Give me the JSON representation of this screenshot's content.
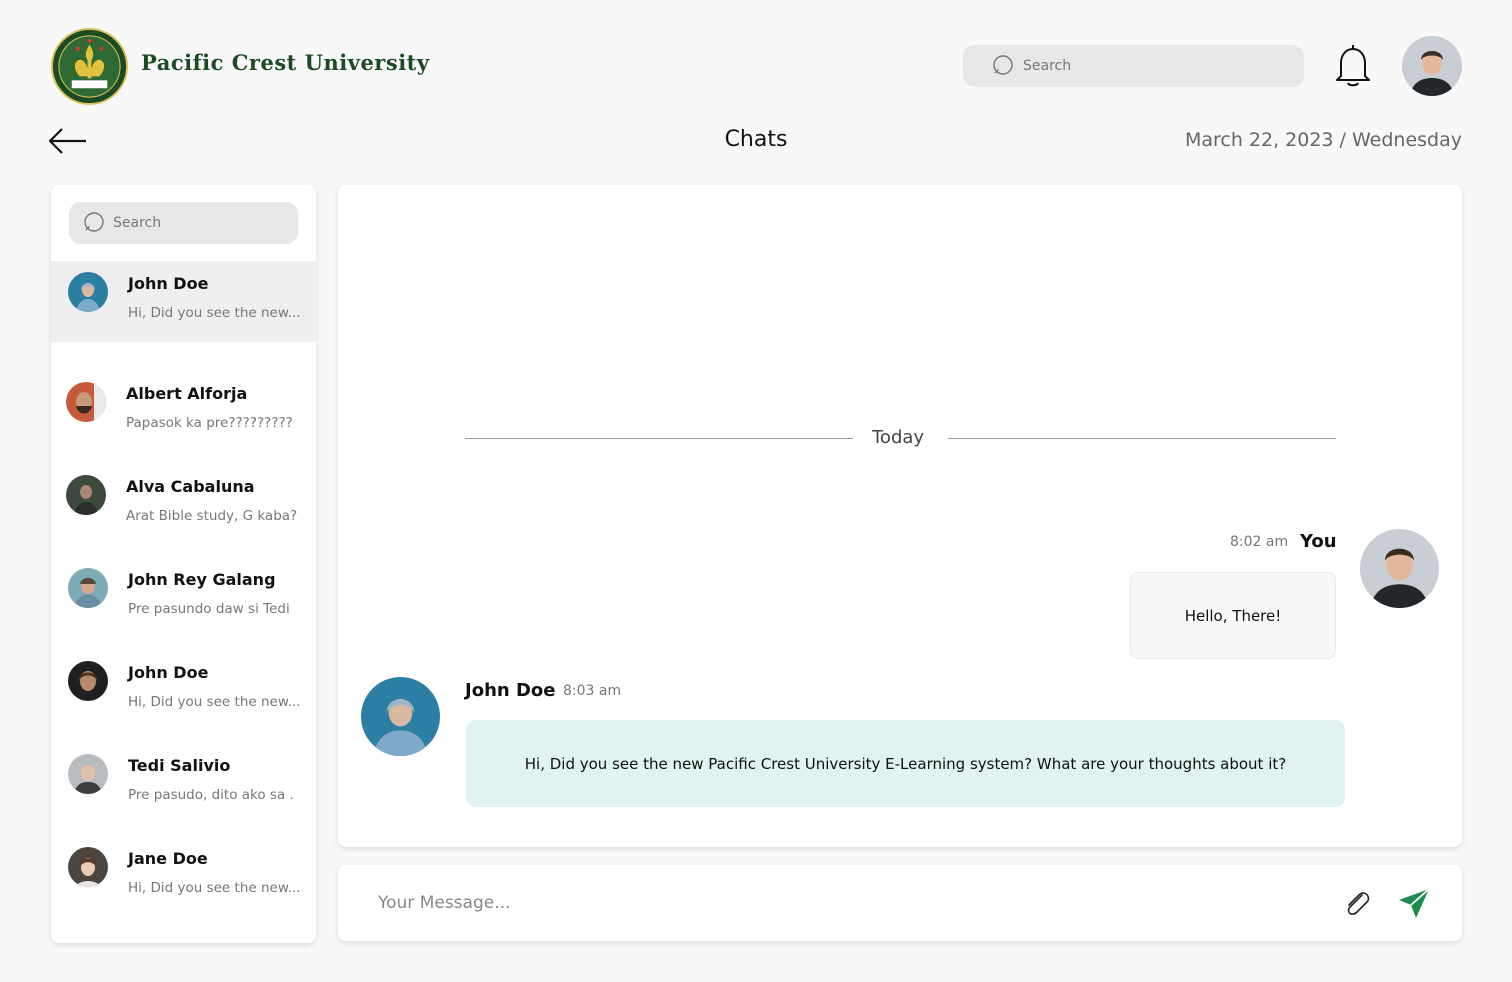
{
  "brand": {
    "name": "Pacific Crest University",
    "logo_icon": "university-crest-logo"
  },
  "header": {
    "search_placeholder": "Search",
    "notification_icon": "bell-icon",
    "back_icon": "arrow-left-icon",
    "title": "Chats",
    "date": "March 22, 2023 / Wednesday"
  },
  "sidebar": {
    "search_placeholder": "Search",
    "chats": [
      {
        "name": "John Doe",
        "preview": "Hi, Did you see the new...",
        "active": true
      },
      {
        "name": "Albert Alforja",
        "preview": "Papasok ka pre?????????"
      },
      {
        "name": "Alva Cabaluna",
        "preview": "Arat Bible study, G kaba?"
      },
      {
        "name": "John Rey Galang",
        "preview": "Pre pasundo daw si Tedi"
      },
      {
        "name": "John Doe",
        "preview": "Hi, Did you see the new..."
      },
      {
        "name": "Tedi Salivio",
        "preview": "Pre pasudo, dito ako sa ."
      },
      {
        "name": "Jane Doe",
        "preview": "Hi, Did you see the new..."
      }
    ]
  },
  "conversation": {
    "day_label": "Today",
    "messages": [
      {
        "sender": "You",
        "time": "8:02 am",
        "text": "Hello, There!"
      },
      {
        "sender": "John Doe",
        "time": "8:03 am",
        "text": "Hi, Did you see the new Pacific Crest University E-Learning system? What are your thoughts about it?"
      }
    ]
  },
  "composer": {
    "placeholder": "Your Message...",
    "attach_icon": "paperclip-icon",
    "send_icon": "send-icon"
  },
  "colors": {
    "accent_green": "#1e8a4c",
    "brand_green": "#1c4a22",
    "incoming_bubble": "#e0f3f0"
  }
}
